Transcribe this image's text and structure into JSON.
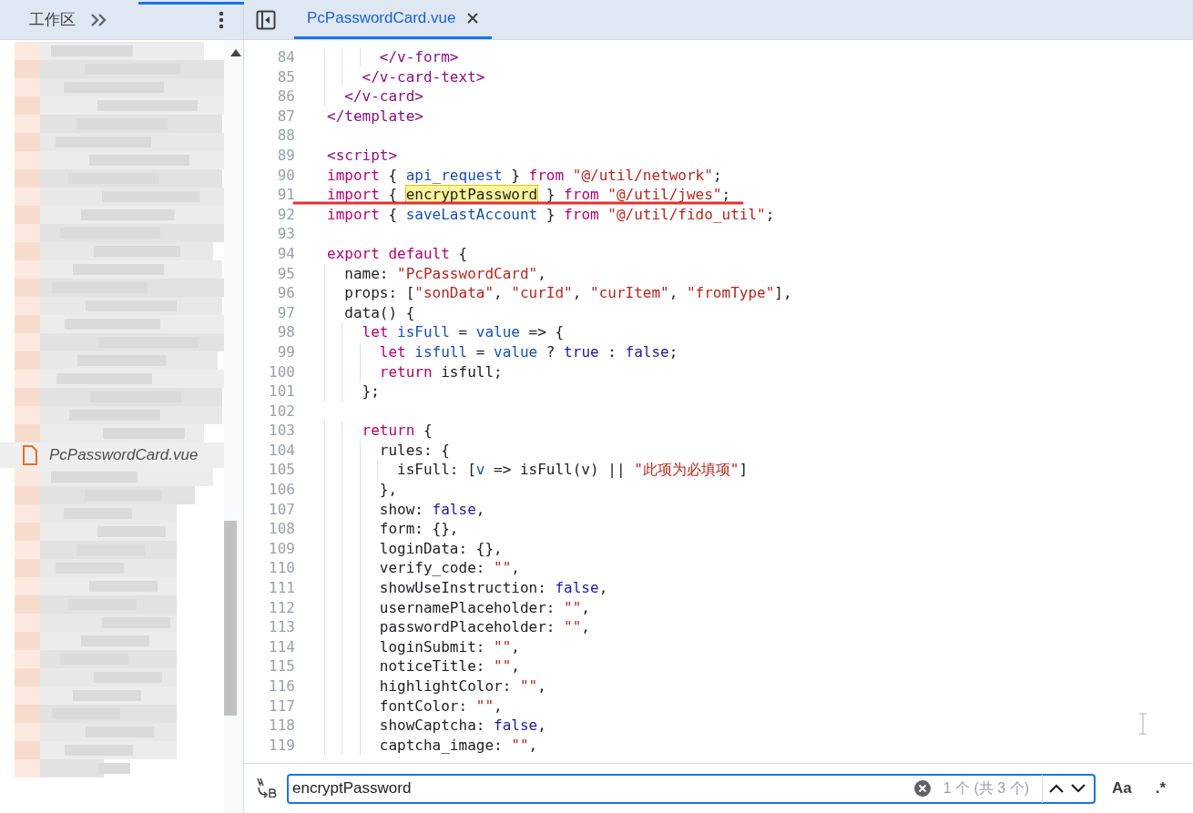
{
  "sidebar": {
    "tab": "工作区",
    "selected_file": {
      "name": "PcPasswordCard.vue",
      "selected": true
    }
  },
  "editor": {
    "tab": {
      "title": "PcPasswordCard.vue",
      "selected": true
    },
    "lines": [
      {
        "number": "84",
        "tokens": [
          {
            "kind": "tag",
            "text": "      </v-form>"
          }
        ]
      },
      {
        "number": "85",
        "tokens": [
          {
            "kind": "tag",
            "text": "    </v-card-text>"
          }
        ]
      },
      {
        "number": "86",
        "tokens": [
          {
            "kind": "tag",
            "text": "  </v-card>"
          }
        ]
      },
      {
        "number": "87",
        "tokens": [
          {
            "kind": "tag",
            "text": "</template>"
          }
        ]
      },
      {
        "number": "88"
      },
      {
        "number": "89",
        "tokens": [
          {
            "kind": "tag",
            "text": "<script>"
          }
        ]
      },
      {
        "number": "90",
        "tokens": [
          {
            "kind": "keyword",
            "text": "import"
          },
          {
            "kind": "plain",
            "text": " { "
          },
          {
            "kind": "name",
            "text": "api_request"
          },
          {
            "kind": "plain",
            "text": " } "
          },
          {
            "kind": "keyword",
            "text": "from"
          },
          {
            "kind": "string",
            "text": " \"@/util/network\""
          },
          {
            "kind": "plain",
            "text": ";"
          }
        ]
      },
      {
        "number": "91",
        "underlined": true,
        "tokens": [
          {
            "kind": "keyword",
            "text": "import"
          },
          {
            "kind": "plain",
            "text": " { "
          },
          {
            "kind": "match",
            "text": "encryptPassword"
          },
          {
            "kind": "plain",
            "text": " } "
          },
          {
            "kind": "keyword",
            "text": "from"
          },
          {
            "kind": "string",
            "text": " \"@/util/jwes\""
          },
          {
            "kind": "plain",
            "text": ";"
          }
        ]
      },
      {
        "number": "92",
        "tokens": [
          {
            "kind": "keyword",
            "text": "import"
          },
          {
            "kind": "plain",
            "text": " { "
          },
          {
            "kind": "name",
            "text": "saveLastAccount"
          },
          {
            "kind": "plain",
            "text": " } "
          },
          {
            "kind": "keyword",
            "text": "from"
          },
          {
            "kind": "string",
            "text": " \"@/util/fido_util\""
          },
          {
            "kind": "plain",
            "text": ";"
          }
        ]
      },
      {
        "number": "93"
      },
      {
        "number": "94",
        "tokens": [
          {
            "kind": "keyword",
            "text": "export default"
          },
          {
            "kind": "plain",
            "text": " {"
          }
        ]
      },
      {
        "number": "95",
        "tokens": [
          {
            "kind": "plain",
            "text": "  name: "
          },
          {
            "kind": "string",
            "text": "\"PcPasswordCard\""
          },
          {
            "kind": "plain",
            "text": ","
          }
        ]
      },
      {
        "number": "96",
        "tokens": [
          {
            "kind": "plain",
            "text": "  props: ["
          },
          {
            "kind": "string",
            "text": "\"sonData\""
          },
          {
            "kind": "plain",
            "text": ", "
          },
          {
            "kind": "string",
            "text": "\"curId\""
          },
          {
            "kind": "plain",
            "text": ", "
          },
          {
            "kind": "string",
            "text": "\"curItem\""
          },
          {
            "kind": "plain",
            "text": ", "
          },
          {
            "kind": "string",
            "text": "\"fromType\""
          },
          {
            "kind": "plain",
            "text": "],"
          }
        ]
      },
      {
        "number": "97",
        "tokens": [
          {
            "kind": "plain",
            "text": "  data() {"
          }
        ]
      },
      {
        "number": "98",
        "tokens": [
          {
            "kind": "keyword",
            "text": "    let "
          },
          {
            "kind": "name",
            "text": "isFull"
          },
          {
            "kind": "plain",
            "text": " = "
          },
          {
            "kind": "name",
            "text": "value"
          },
          {
            "kind": "plain",
            "text": " => {"
          }
        ]
      },
      {
        "number": "99",
        "tokens": [
          {
            "kind": "keyword",
            "text": "      let "
          },
          {
            "kind": "name",
            "text": "isfull"
          },
          {
            "kind": "plain",
            "text": " = "
          },
          {
            "kind": "name",
            "text": "value"
          },
          {
            "kind": "plain",
            "text": " ? "
          },
          {
            "kind": "literal",
            "text": "true"
          },
          {
            "kind": "plain",
            "text": " : "
          },
          {
            "kind": "literal",
            "text": "false"
          },
          {
            "kind": "plain",
            "text": ";"
          }
        ]
      },
      {
        "number": "100",
        "tokens": [
          {
            "kind": "keyword",
            "text": "      return"
          },
          {
            "kind": "plain",
            "text": " isfull;"
          }
        ]
      },
      {
        "number": "101",
        "tokens": [
          {
            "kind": "plain",
            "text": "    };"
          }
        ]
      },
      {
        "number": "102"
      },
      {
        "number": "103",
        "tokens": [
          {
            "kind": "keyword",
            "text": "    return"
          },
          {
            "kind": "plain",
            "text": " {"
          }
        ]
      },
      {
        "number": "104",
        "tokens": [
          {
            "kind": "plain",
            "text": "      rules: {"
          }
        ]
      },
      {
        "number": "105",
        "tokens": [
          {
            "kind": "plain",
            "text": "        isFull: ["
          },
          {
            "kind": "name",
            "text": "v"
          },
          {
            "kind": "plain",
            "text": " => isFull(v) || "
          },
          {
            "kind": "string",
            "text": "\"此项为必填项\""
          },
          {
            "kind": "plain",
            "text": "]"
          }
        ]
      },
      {
        "number": "106",
        "tokens": [
          {
            "kind": "plain",
            "text": "      },"
          }
        ]
      },
      {
        "number": "107",
        "tokens": [
          {
            "kind": "plain",
            "text": "      show: "
          },
          {
            "kind": "literal",
            "text": "false"
          },
          {
            "kind": "plain",
            "text": ","
          }
        ]
      },
      {
        "number": "108",
        "tokens": [
          {
            "kind": "plain",
            "text": "      form: {},"
          }
        ]
      },
      {
        "number": "109",
        "tokens": [
          {
            "kind": "plain",
            "text": "      loginData: {},"
          }
        ]
      },
      {
        "number": "110",
        "tokens": [
          {
            "kind": "plain",
            "text": "      verify_code: "
          },
          {
            "kind": "string",
            "text": "\"\""
          },
          {
            "kind": "plain",
            "text": ","
          }
        ]
      },
      {
        "number": "111",
        "tokens": [
          {
            "kind": "plain",
            "text": "      showUseInstruction: "
          },
          {
            "kind": "literal",
            "text": "false"
          },
          {
            "kind": "plain",
            "text": ","
          }
        ]
      },
      {
        "number": "112",
        "tokens": [
          {
            "kind": "plain",
            "text": "      usernamePlaceholder: "
          },
          {
            "kind": "string",
            "text": "\"\""
          },
          {
            "kind": "plain",
            "text": ","
          }
        ]
      },
      {
        "number": "113",
        "tokens": [
          {
            "kind": "plain",
            "text": "      passwordPlaceholder: "
          },
          {
            "kind": "string",
            "text": "\"\""
          },
          {
            "kind": "plain",
            "text": ","
          }
        ]
      },
      {
        "number": "114",
        "tokens": [
          {
            "kind": "plain",
            "text": "      loginSubmit: "
          },
          {
            "kind": "string",
            "text": "\"\""
          },
          {
            "kind": "plain",
            "text": ","
          }
        ]
      },
      {
        "number": "115",
        "tokens": [
          {
            "kind": "plain",
            "text": "      noticeTitle: "
          },
          {
            "kind": "string",
            "text": "\"\""
          },
          {
            "kind": "plain",
            "text": ","
          }
        ]
      },
      {
        "number": "116",
        "tokens": [
          {
            "kind": "plain",
            "text": "      highlightColor: "
          },
          {
            "kind": "string",
            "text": "\"\""
          },
          {
            "kind": "plain",
            "text": ","
          }
        ]
      },
      {
        "number": "117",
        "tokens": [
          {
            "kind": "plain",
            "text": "      fontColor: "
          },
          {
            "kind": "string",
            "text": "\"\""
          },
          {
            "kind": "plain",
            "text": ","
          }
        ]
      },
      {
        "number": "118",
        "tokens": [
          {
            "kind": "plain",
            "text": "      showCaptcha: "
          },
          {
            "kind": "literal",
            "text": "false"
          },
          {
            "kind": "plain",
            "text": ","
          }
        ]
      },
      {
        "number": "119",
        "tokens": [
          {
            "kind": "plain",
            "text": "      captcha_image: "
          },
          {
            "kind": "string",
            "text": "\"\""
          },
          {
            "kind": "plain",
            "text": ","
          }
        ]
      }
    ]
  },
  "find_bar": {
    "value": "encryptPassword",
    "count": "1 个 (共 3 个)",
    "match_case": "Aa",
    "regex": ".*",
    "match_case_on": false,
    "regex_on": false
  }
}
